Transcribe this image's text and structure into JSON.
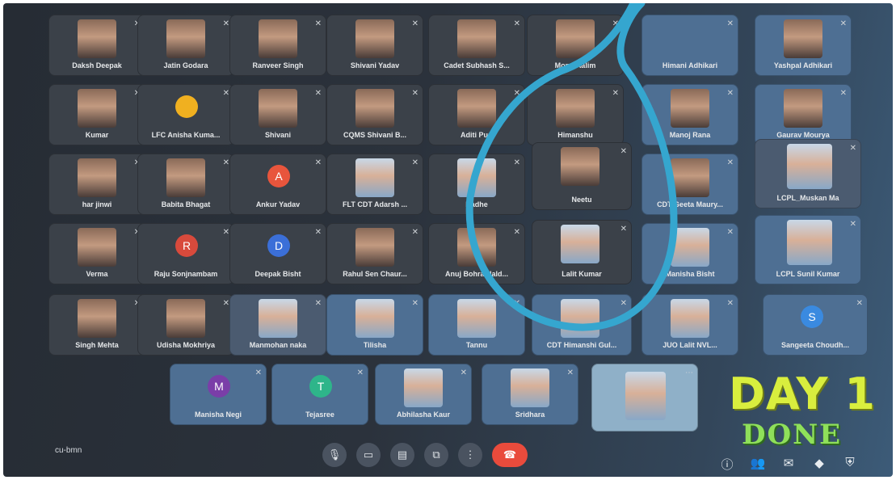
{
  "meeting": {
    "code": "cu-bmn",
    "overlay_title": "DAY 1",
    "overlay_subtitle": "DONE"
  },
  "grid": {
    "row1": [
      "Daksh Deepak",
      "Jatin Godara",
      "Ranveer Singh",
      "Shivani Yadav",
      "Cadet Subhash S...",
      "Mond Aalim",
      "",
      "Himani Adhikari",
      "Yashpal Adhikari"
    ],
    "row2": [
      "Kumar",
      "LFC Anisha Kuma...",
      "Shivani",
      "CQMS Shivani B...",
      "Aditi Puri",
      "Himanshu",
      "",
      "Manoj Rana",
      "Gaurav Mourya"
    ],
    "row3": [
      "har jinwi",
      "Babita Bhagat",
      "Ankur Yadav",
      "FLT CDT Adarsh ...",
      "Radhe",
      "Neetu",
      "",
      "CDT Geeta Maury...",
      "LCPL_Muskan Ma"
    ],
    "row4": [
      "Verma",
      "Raju Sonjnambam",
      "Deepak Bisht",
      "Rahul Sen Chaur...",
      "Anuj Bohra Hald...",
      "Lalit Kumar",
      "",
      "Manisha Bisht",
      "LCPL Sunil Kumar"
    ],
    "row5": [
      "Singh Mehta",
      "Udisha Mokhriya",
      "Manmohan naka",
      "Tilisha",
      "Tannu",
      "CDT Himanshi Gul...",
      "",
      "JUO Lalit NVL...",
      "Sangeeta Choudh..."
    ],
    "row6": [
      "Manisha Negi",
      "Tejasree",
      "Abhilasha Kaur",
      "Sridhara",
      ""
    ]
  },
  "avatars": {
    "ankur": "A",
    "raju": "R",
    "deepak": "D",
    "manisha_negi": "M",
    "tejasree": "T",
    "sangeeta": "S"
  },
  "icons": {
    "mic": "mic-icon",
    "camera": "camera-icon",
    "captions": "captions-icon",
    "present": "present-icon",
    "more": "more-icon",
    "end_call": "end-call-icon",
    "info": "info-icon",
    "people": "people-icon",
    "chat": "chat-icon",
    "activities": "activities-icon",
    "host_controls": "shield-icon"
  },
  "colors": {
    "highlight_circle": "#35a6cf",
    "end_call": "#e94b3c",
    "day_text": "#d9ee3e",
    "done_text": "#8fe05a"
  }
}
